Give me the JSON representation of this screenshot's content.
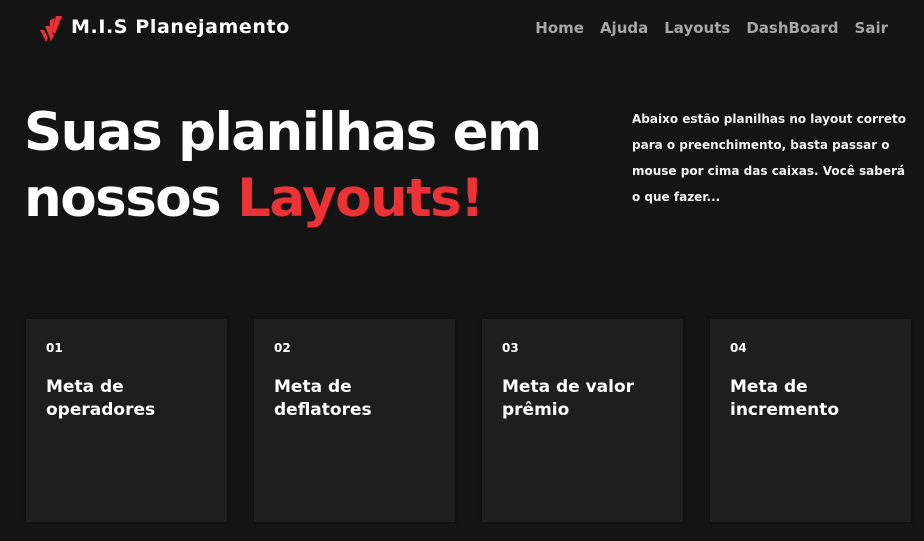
{
  "header": {
    "brand": "M.I.S Planejamento",
    "logo_icon": "red-stripes-logo-icon",
    "accent_color": "#ea3237",
    "nav": [
      {
        "label": "Home"
      },
      {
        "label": "Ajuda"
      },
      {
        "label": "Layouts"
      },
      {
        "label": "DashBoard"
      },
      {
        "label": "Sair"
      }
    ]
  },
  "hero": {
    "title_line1": "Suas planilhas em",
    "title_line2_prefix": "nossos ",
    "title_line2_accent": "Layouts!",
    "description": "Abaixo estão planilhas no layout correto para o preenchimento, basta passar o mouse por cima das caixas. Você saberá o que fazer..."
  },
  "cards": [
    {
      "number": "01",
      "title": "Meta de operadores"
    },
    {
      "number": "02",
      "title": "Meta de deflatores"
    },
    {
      "number": "03",
      "title": "Meta de valor prêmio"
    },
    {
      "number": "04",
      "title": "Meta de incremento"
    }
  ]
}
